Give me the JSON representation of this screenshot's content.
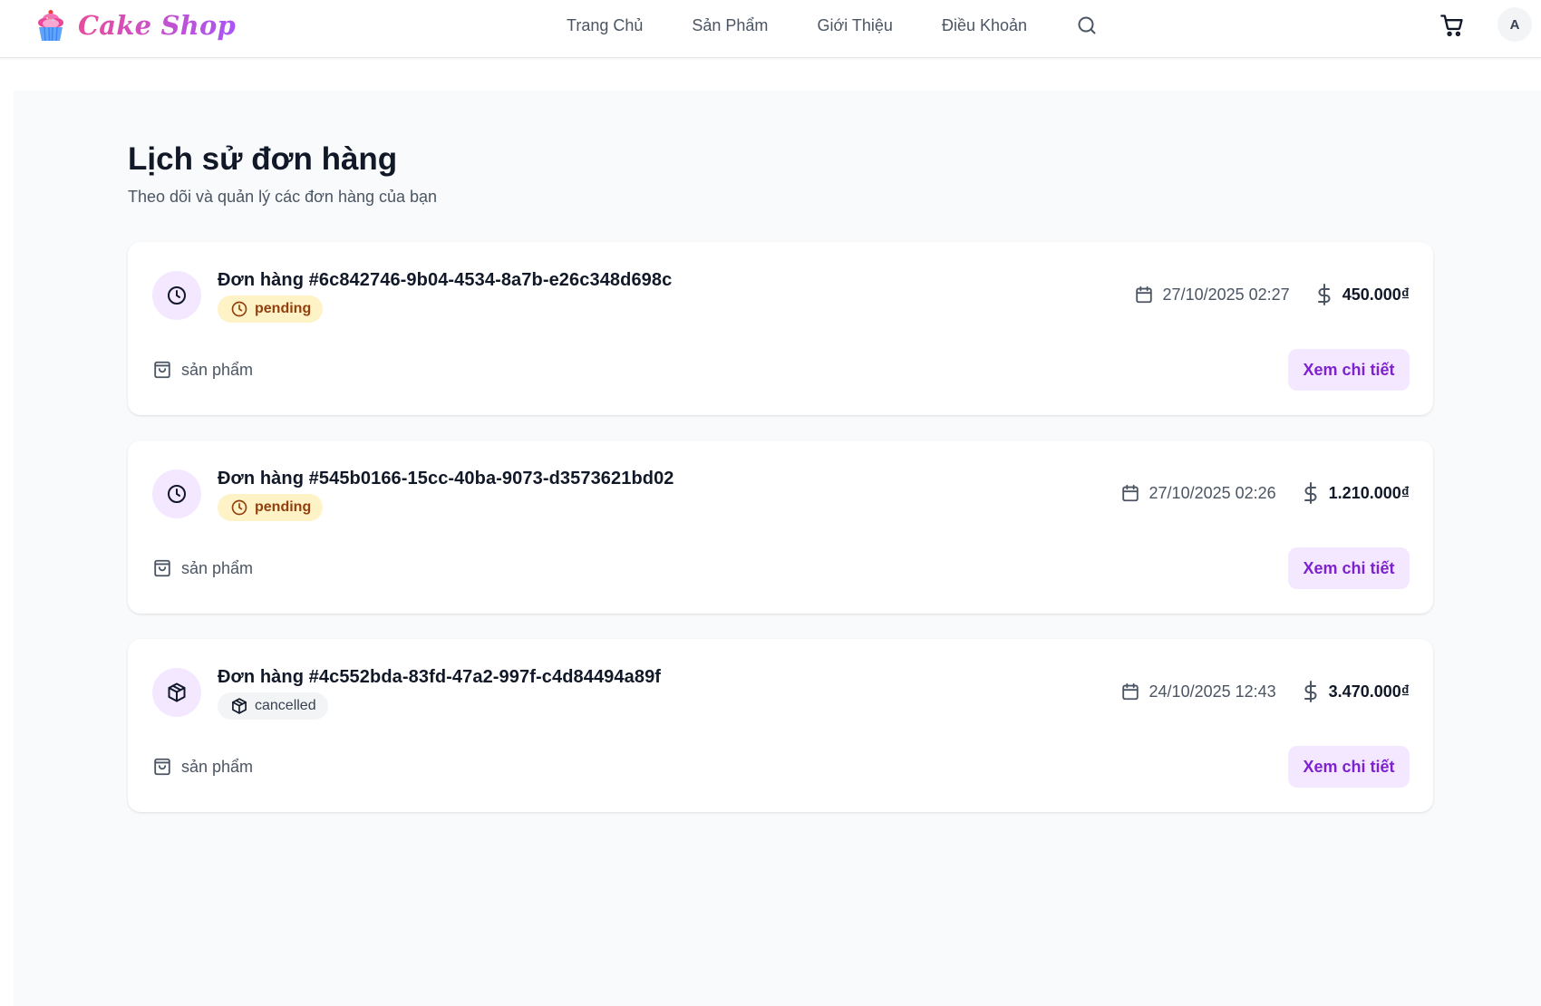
{
  "header": {
    "brand": "Cake Shop",
    "nav": [
      "Trang Chủ",
      "Sản Phẩm",
      "Giới Thiệu",
      "Điều Khoản"
    ],
    "icons": {
      "logo": "cupcake-icon",
      "search": "search-icon",
      "cart": "cart-icon"
    },
    "avatar_initial": "A"
  },
  "page": {
    "title": "Lịch sử đơn hàng",
    "subtitle": "Theo dõi và quản lý các đơn hàng của bạn"
  },
  "orders": [
    {
      "title": "Đơn hàng #6c842746-9b04-4534-8a7b-e26c348d698c",
      "status": "pending",
      "status_icon": "clock-icon",
      "date": "27/10/2025 02:27",
      "total": "450.000₫",
      "items_label": "sản phẩm",
      "action_label": "Xem chi tiết"
    },
    {
      "title": "Đơn hàng #545b0166-15cc-40ba-9073-d3573621bd02",
      "status": "pending",
      "status_icon": "clock-icon",
      "date": "27/10/2025 02:26",
      "total": "1.210.000₫",
      "items_label": "sản phẩm",
      "action_label": "Xem chi tiết"
    },
    {
      "title": "Đơn hàng #4c552bda-83fd-47a2-997f-c4d84494a89f",
      "status": "cancelled",
      "status_icon": "package-icon",
      "date": "24/10/2025 12:43",
      "total": "3.470.000₫",
      "items_label": "sản phẩm",
      "action_label": "Xem chi tiết"
    }
  ],
  "colors": {
    "brand_pink": "#e84c9c",
    "brand_purple": "#a855f7",
    "accent_purple": "#7e22ce",
    "accent_purple_bg": "#f3e8ff",
    "pending_bg": "#fef3c7",
    "pending_text": "#92400e",
    "cancelled_bg": "#f3f4f6"
  }
}
